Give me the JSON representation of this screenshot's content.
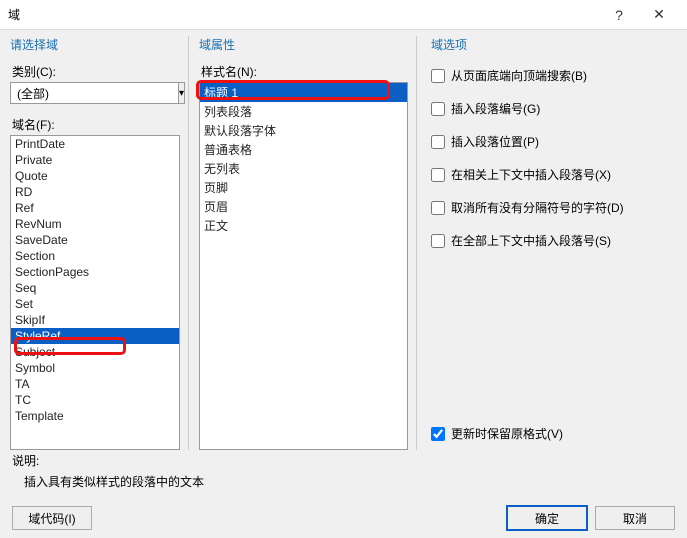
{
  "titlebar": {
    "title": "域"
  },
  "left": {
    "header": "请选择域",
    "category_label": "类别(C):",
    "category_value": "(全部)",
    "fieldname_label": "域名(F):",
    "items": [
      "PrintDate",
      "Private",
      "Quote",
      "RD",
      "Ref",
      "RevNum",
      "SaveDate",
      "Section",
      "SectionPages",
      "Seq",
      "Set",
      "SkipIf",
      "StyleRef",
      "Subject",
      "Symbol",
      "TA",
      "TC",
      "Template"
    ],
    "selected": "StyleRef"
  },
  "mid": {
    "header": "域属性",
    "stylename_label": "样式名(N):",
    "items": [
      "标题 1",
      "列表段落",
      "默认段落字体",
      "普通表格",
      "无列表",
      "页脚",
      "页眉",
      "正文"
    ],
    "selected": "标题 1"
  },
  "right": {
    "header": "域选项",
    "opts": {
      "o1": "从页面底端向顶端搜索(B)",
      "o2": "插入段落编号(G)",
      "o3": "插入段落位置(P)",
      "o4": "在相关上下文中插入段落号(X)",
      "o5": "取消所有没有分隔符号的字符(D)",
      "o6": "在全部上下文中插入段落号(S)"
    },
    "preserve": "更新时保留原格式(V)"
  },
  "desc": {
    "label": "说明:",
    "text": "插入具有类似样式的段落中的文本"
  },
  "footer": {
    "fieldcodes": "域代码(I)",
    "ok": "确定",
    "cancel": "取消"
  }
}
